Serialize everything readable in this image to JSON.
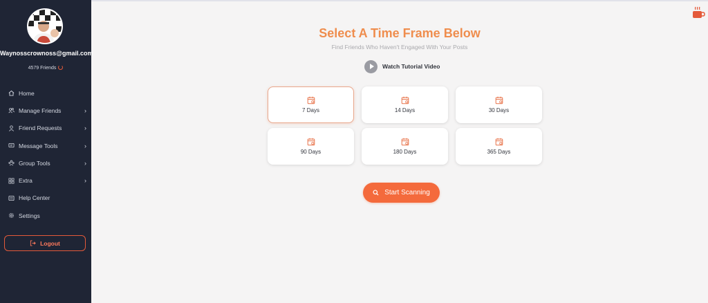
{
  "sidebar": {
    "email": "Waynosscrownoss@gmail.com",
    "friends_count": "4579 Friends",
    "items": [
      {
        "label": "Home",
        "icon": "home-icon",
        "has_submenu": false
      },
      {
        "label": "Manage Friends",
        "icon": "users-icon",
        "has_submenu": true
      },
      {
        "label": "Friend Requests",
        "icon": "user-icon",
        "has_submenu": true
      },
      {
        "label": "Message Tools",
        "icon": "message-icon",
        "has_submenu": true
      },
      {
        "label": "Group Tools",
        "icon": "group-icon",
        "has_submenu": true
      },
      {
        "label": "Extra",
        "icon": "grid-icon",
        "has_submenu": true
      },
      {
        "label": "Help Center",
        "icon": "help-icon",
        "has_submenu": false
      },
      {
        "label": "Settings",
        "icon": "gear-icon",
        "has_submenu": false
      }
    ],
    "logout_label": "Logout"
  },
  "main": {
    "title": "Select A Time Frame Below",
    "subtitle": "Find Friends Who Haven't Engaged With Your Posts",
    "tutorial_label": "Watch Tutorial Video",
    "time_frames": [
      {
        "label": "7 Days",
        "selected": true
      },
      {
        "label": "14 Days",
        "selected": false
      },
      {
        "label": "30 Days",
        "selected": false
      },
      {
        "label": "90 Days",
        "selected": false
      },
      {
        "label": "180 Days",
        "selected": false
      },
      {
        "label": "365 Days",
        "selected": false
      }
    ],
    "scan_label": "Start Scanning"
  },
  "colors": {
    "sidebar_bg": "#1f2535",
    "accent": "#f46a3c",
    "title": "#ef8d4d",
    "main_bg": "#f5f4f4"
  }
}
